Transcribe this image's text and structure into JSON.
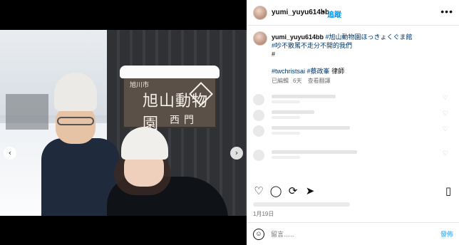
{
  "post": {
    "username": "yumi_yuyu614bb",
    "follow_label": "追蹤",
    "more_label": "•••",
    "caption_user": "yumi_yuyu614bb",
    "caption_tag1": "#旭山動物園ほっきょくぐま館",
    "caption_tag2": "#吵不散罵不走分不開的我們",
    "caption_hash": "#",
    "caption_tag3": "#twchristsai",
    "caption_tag4": "#蔡政峯",
    "caption_tail": "律師",
    "edited_label": "已編輯",
    "time_ago": "6天",
    "translate_label": "查看翻譯",
    "date": "1月19日"
  },
  "media": {
    "sign_line1": "旭川市",
    "sign_line2": "旭山動物園",
    "sign_line3": "西門",
    "prev_arrow": "‹",
    "next_arrow": "›"
  },
  "icons": {
    "like": "heart-icon",
    "comment": "comment-icon",
    "share": "share-icon",
    "save": "bookmark-icon",
    "emoji": "emoji-icon"
  },
  "comment_input": {
    "placeholder": "留言......",
    "post_label": "發佈"
  },
  "colors": {
    "link": "#0095f6",
    "hashtag": "#00376b",
    "muted": "#737373"
  }
}
